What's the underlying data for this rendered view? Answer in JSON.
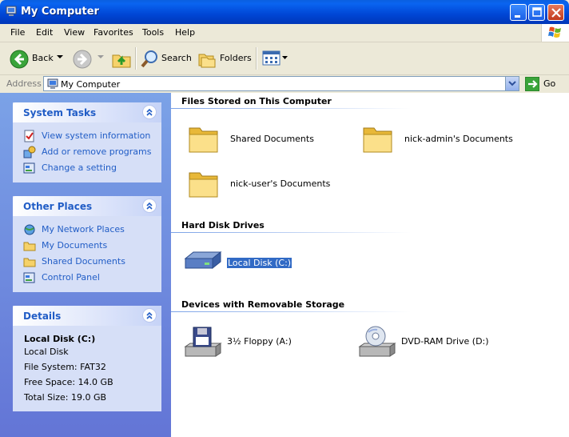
{
  "window": {
    "title": "My Computer",
    "colors": {
      "titlebar": "#0046d5",
      "taskpane": "#6375d6",
      "link": "#215dc6",
      "selection": "#316ac5"
    }
  },
  "menu": [
    "File",
    "Edit",
    "View",
    "Favorites",
    "Tools",
    "Help"
  ],
  "toolbar": {
    "back": "Back",
    "search": "Search",
    "folders": "Folders"
  },
  "address": {
    "label": "Address",
    "value": "My Computer",
    "go": "Go"
  },
  "system_tasks": {
    "title": "System Tasks",
    "items": [
      "View system information",
      "Add or remove programs",
      "Change a setting"
    ]
  },
  "other_places": {
    "title": "Other Places",
    "items": [
      "My Network Places",
      "My Documents",
      "Shared Documents",
      "Control Panel"
    ]
  },
  "details": {
    "title": "Details",
    "name": "Local Disk (C:)",
    "type": "Local Disk",
    "file_system": "File System: FAT32",
    "free_space": "Free Space: 14.0 GB",
    "total_size": "Total Size: 19.0 GB"
  },
  "groups": {
    "files": {
      "title": "Files Stored on This Computer",
      "items": [
        "Shared Documents",
        "nick-admin's Documents",
        "nick-user's Documents"
      ]
    },
    "hard_disks": {
      "title": "Hard Disk Drives",
      "items": [
        "Local Disk (C:)"
      ]
    },
    "removable": {
      "title": "Devices with Removable Storage",
      "items": [
        "3½ Floppy (A:)",
        "DVD-RAM Drive (D:)"
      ]
    }
  }
}
